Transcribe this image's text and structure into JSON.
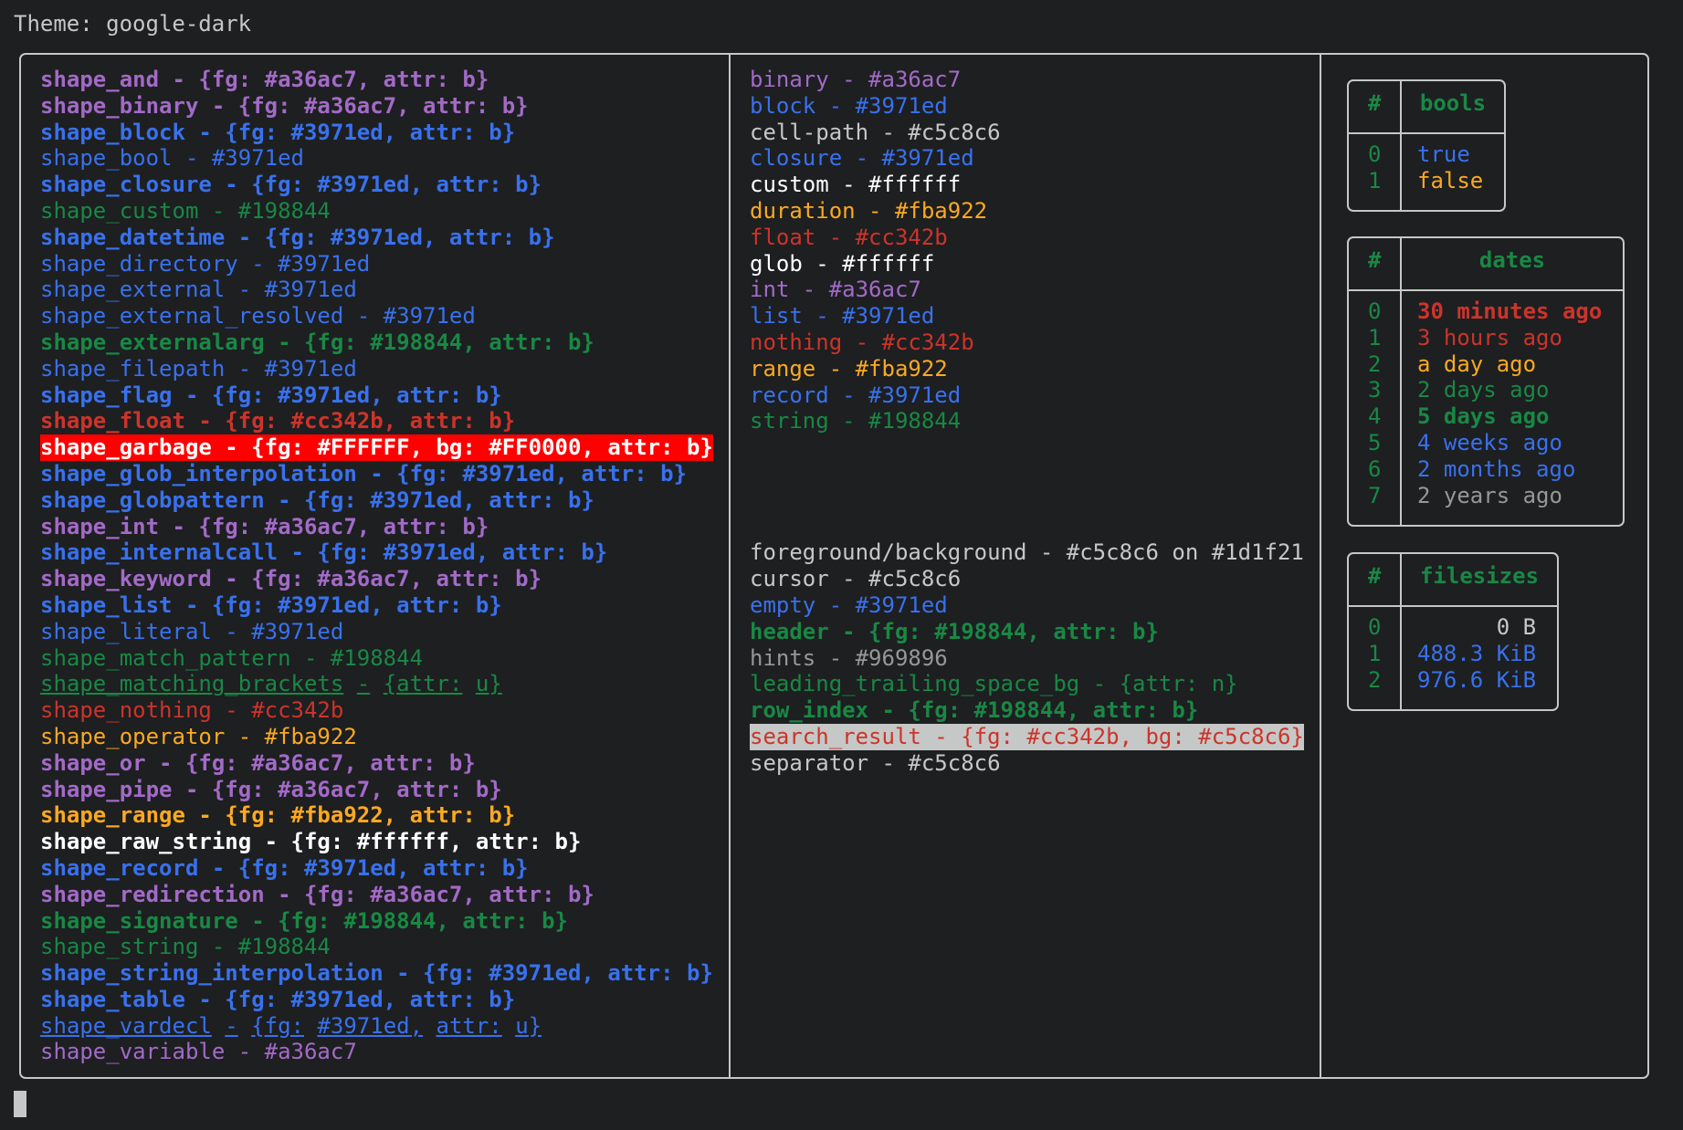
{
  "title": "Theme: google-dark",
  "colors": {
    "background": "#1d1f21",
    "foreground": "#c5c8c6",
    "purple": "#a36ac7",
    "blue": "#3971ed",
    "green": "#198844",
    "red": "#cc342b",
    "orange": "#fba922",
    "white": "#ffffff",
    "gray": "#969896",
    "garbage_bg": "#FF0000"
  },
  "shapes": [
    {
      "text": "shape_and - {fg: #a36ac7, attr: b}",
      "fg": "#a36ac7",
      "bold": true
    },
    {
      "text": "shape_binary - {fg: #a36ac7, attr: b}",
      "fg": "#a36ac7",
      "bold": true
    },
    {
      "text": "shape_block - {fg: #3971ed, attr: b}",
      "fg": "#3971ed",
      "bold": true
    },
    {
      "text": "shape_bool - #3971ed",
      "fg": "#3971ed",
      "bold": false
    },
    {
      "text": "shape_closure - {fg: #3971ed, attr: b}",
      "fg": "#3971ed",
      "bold": true
    },
    {
      "text": "shape_custom - #198844",
      "fg": "#198844",
      "bold": false
    },
    {
      "text": "shape_datetime - {fg: #3971ed, attr: b}",
      "fg": "#3971ed",
      "bold": true
    },
    {
      "text": "shape_directory - #3971ed",
      "fg": "#3971ed",
      "bold": false
    },
    {
      "text": "shape_external - #3971ed",
      "fg": "#3971ed",
      "bold": false
    },
    {
      "text": "shape_external_resolved - #3971ed",
      "fg": "#3971ed",
      "bold": false
    },
    {
      "text": "shape_externalarg - {fg: #198844, attr: b}",
      "fg": "#198844",
      "bold": true
    },
    {
      "text": "shape_filepath - #3971ed",
      "fg": "#3971ed",
      "bold": false
    },
    {
      "text": "shape_flag - {fg: #3971ed, attr: b}",
      "fg": "#3971ed",
      "bold": true
    },
    {
      "text": "shape_float - {fg: #cc342b, attr: b}",
      "fg": "#cc342b",
      "bold": true
    },
    {
      "text": "shape_garbage - {fg: #FFFFFF, bg: #FF0000, attr: b}",
      "fg": "#FFFFFF",
      "bg": "#FF0000",
      "bold": true
    },
    {
      "text": "shape_glob_interpolation - {fg: #3971ed, attr: b}",
      "fg": "#3971ed",
      "bold": true
    },
    {
      "text": "shape_globpattern - {fg: #3971ed, attr: b}",
      "fg": "#3971ed",
      "bold": true
    },
    {
      "text": "shape_int - {fg: #a36ac7, attr: b}",
      "fg": "#a36ac7",
      "bold": true
    },
    {
      "text": "shape_internalcall - {fg: #3971ed, attr: b}",
      "fg": "#3971ed",
      "bold": true
    },
    {
      "text": "shape_keyword - {fg: #a36ac7, attr: b}",
      "fg": "#a36ac7",
      "bold": true
    },
    {
      "text": "shape_list - {fg: #3971ed, attr: b}",
      "fg": "#3971ed",
      "bold": true
    },
    {
      "text": "shape_literal - #3971ed",
      "fg": "#3971ed",
      "bold": false
    },
    {
      "text": "shape_match_pattern - #198844",
      "fg": "#198844",
      "bold": false
    },
    {
      "text": "shape_matching_brackets - {attr: u}",
      "fg": "#198844",
      "bold": false,
      "underline": true
    },
    {
      "text": "shape_nothing - #cc342b",
      "fg": "#cc342b",
      "bold": false
    },
    {
      "text": "shape_operator - #fba922",
      "fg": "#fba922",
      "bold": false
    },
    {
      "text": "shape_or - {fg: #a36ac7, attr: b}",
      "fg": "#a36ac7",
      "bold": true
    },
    {
      "text": "shape_pipe - {fg: #a36ac7, attr: b}",
      "fg": "#a36ac7",
      "bold": true
    },
    {
      "text": "shape_range - {fg: #fba922, attr: b}",
      "fg": "#fba922",
      "bold": true
    },
    {
      "text": "shape_raw_string - {fg: #ffffff, attr: b}",
      "fg": "#ffffff",
      "bold": true
    },
    {
      "text": "shape_record - {fg: #3971ed, attr: b}",
      "fg": "#3971ed",
      "bold": true
    },
    {
      "text": "shape_redirection - {fg: #a36ac7, attr: b}",
      "fg": "#a36ac7",
      "bold": true
    },
    {
      "text": "shape_signature - {fg: #198844, attr: b}",
      "fg": "#198844",
      "bold": true
    },
    {
      "text": "shape_string - #198844",
      "fg": "#198844",
      "bold": false
    },
    {
      "text": "shape_string_interpolation - {fg: #3971ed, attr: b}",
      "fg": "#3971ed",
      "bold": true
    },
    {
      "text": "shape_table - {fg: #3971ed, attr: b}",
      "fg": "#3971ed",
      "bold": true
    },
    {
      "text": "shape_vardecl - {fg: #3971ed, attr: u}",
      "fg": "#3971ed",
      "bold": false,
      "underline": true
    },
    {
      "text": "shape_variable - #a36ac7",
      "fg": "#a36ac7",
      "bold": false
    }
  ],
  "types": [
    {
      "text": "binary - #a36ac7",
      "fg": "#a36ac7"
    },
    {
      "text": "block - #3971ed",
      "fg": "#3971ed"
    },
    {
      "text": "cell-path - #c5c8c6",
      "fg": "#c5c8c6"
    },
    {
      "text": "closure - #3971ed",
      "fg": "#3971ed"
    },
    {
      "text": "custom - #ffffff",
      "fg": "#ffffff"
    },
    {
      "text": "duration - #fba922",
      "fg": "#fba922"
    },
    {
      "text": "float - #cc342b",
      "fg": "#cc342b"
    },
    {
      "text": "glob - #ffffff",
      "fg": "#ffffff"
    },
    {
      "text": "int - #a36ac7",
      "fg": "#a36ac7"
    },
    {
      "text": "list - #3971ed",
      "fg": "#3971ed"
    },
    {
      "text": "nothing - #cc342b",
      "fg": "#cc342b"
    },
    {
      "text": "range - #fba922",
      "fg": "#fba922"
    },
    {
      "text": "record - #3971ed",
      "fg": "#3971ed"
    },
    {
      "text": "string - #198844",
      "fg": "#198844"
    }
  ],
  "ui_colors": [
    {
      "text": "foreground/background - #c5c8c6 on #1d1f21",
      "fg": "#c5c8c6"
    },
    {
      "text": "cursor - #c5c8c6",
      "fg": "#c5c8c6"
    },
    {
      "text": "empty - #3971ed",
      "fg": "#3971ed"
    },
    {
      "text": "header - {fg: #198844, attr: b}",
      "fg": "#198844",
      "bold": true
    },
    {
      "text": "hints - #969896",
      "fg": "#969896"
    },
    {
      "text": "leading_trailing_space_bg - {attr: n}",
      "fg": "#198844"
    },
    {
      "text": "row_index - {fg: #198844, attr: b}",
      "fg": "#198844",
      "bold": true
    },
    {
      "text": "search_result - {fg: #cc342b, bg: #c5c8c6}",
      "fg": "#cc342b",
      "bg": "#c5c8c6"
    },
    {
      "text": "separator - #c5c8c6",
      "fg": "#c5c8c6"
    }
  ],
  "tables": {
    "bools": {
      "index_header": "#",
      "header": "bools",
      "rows": [
        {
          "index": "0",
          "value": "true",
          "fg": "#3971ed"
        },
        {
          "index": "1",
          "value": "false",
          "fg": "#fba922"
        }
      ]
    },
    "dates": {
      "index_header": "#",
      "header": "dates",
      "rows": [
        {
          "index": "0",
          "value": "30 minutes ago",
          "fg": "#cc342b",
          "bold": true
        },
        {
          "index": "1",
          "value": "3 hours ago",
          "fg": "#cc342b"
        },
        {
          "index": "2",
          "value": "a day ago",
          "fg": "#fba922"
        },
        {
          "index": "3",
          "value": "2 days ago",
          "fg": "#198844"
        },
        {
          "index": "4",
          "value": "5 days ago",
          "fg": "#198844",
          "bold": true
        },
        {
          "index": "5",
          "value": "4 weeks ago",
          "fg": "#3971ed"
        },
        {
          "index": "6",
          "value": "2 months ago",
          "fg": "#3971ed"
        },
        {
          "index": "7",
          "value": "2 years ago",
          "fg": "#969896"
        }
      ]
    },
    "filesizes": {
      "index_header": "#",
      "header": "filesizes",
      "rows": [
        {
          "index": "0",
          "value": "0 B",
          "fg": "#c5c8c6"
        },
        {
          "index": "1",
          "value": "488.3 KiB",
          "fg": "#3971ed"
        },
        {
          "index": "2",
          "value": "976.6 KiB",
          "fg": "#3971ed"
        }
      ]
    }
  }
}
